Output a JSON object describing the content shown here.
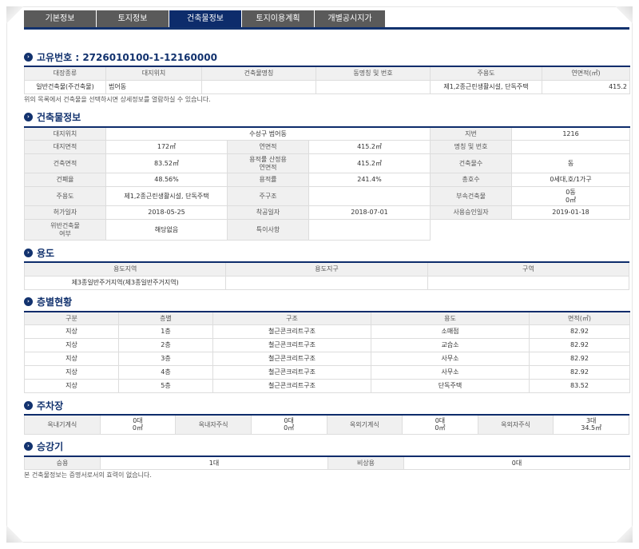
{
  "tabs": [
    "기본정보",
    "토지정보",
    "건축물정보",
    "토지이용계획",
    "개별공시지가"
  ],
  "active_tab": 2,
  "bullet_icon": "›",
  "unique_id_title": "고유번호 : 2726010100-1-12160000",
  "ledger": {
    "headers": [
      "대장종류",
      "대지위치",
      "건축물명칭",
      "동명칭 및 번호",
      "주용도",
      "연면적(㎡)"
    ],
    "row": [
      "일반건축물(주건축물)",
      "범어동",
      "",
      "",
      "제1,2종근린생활시설, 단독주택",
      "415.2"
    ],
    "note": "위의 목록에서 건축물을 선택하시면 상세정보를 열람하실 수 있습니다."
  },
  "building_info": {
    "title": "건축물정보",
    "site_location_label": "대지위치",
    "site_location": "수성구 범어동",
    "lot_label": "지번",
    "lot": "1216",
    "site_area_label": "대지면적",
    "site_area": "172㎡",
    "total_floor_area_label": "연면적",
    "total_floor_area": "415.2㎡",
    "name_label": "명칭 및 번호",
    "name": "",
    "building_area_label": "건축면적",
    "building_area": "83.52㎡",
    "far_floor_area_label": "용적률 산정용\n연면적",
    "far_floor_area": "415.2㎡",
    "building_count_label": "건축물수",
    "building_count": "동",
    "bcr_label": "건폐율",
    "bcr": "48.56%",
    "far_label": "용적률",
    "far": "241.4%",
    "households_label": "총호수",
    "households": "0세대,호/1가구",
    "main_use_label": "주용도",
    "main_use": "제1,2종근린생활시설, 단독주택",
    "main_structure_label": "주구조",
    "main_structure": "",
    "annex_label": "부속건축물",
    "annex": "0동\n0㎡",
    "permit_date_label": "허가일자",
    "permit_date": "2018-05-25",
    "start_date_label": "착공일자",
    "start_date": "2018-07-01",
    "approval_date_label": "사용승인일자",
    "approval_date": "2019-01-18",
    "violation_label": "위반건축물\n여부",
    "violation": "해당없음",
    "remarks_label": "특이사항",
    "remarks": ""
  },
  "usage": {
    "title": "용도",
    "headers": [
      "용도지역",
      "용도지구",
      "구역"
    ],
    "row": [
      "제3종일반주거지역(제3종일반주거지역)",
      "",
      ""
    ]
  },
  "floors": {
    "title": "층별현황",
    "headers": [
      "구분",
      "층별",
      "구조",
      "용도",
      "면적(㎡)"
    ],
    "rows": [
      [
        "지상",
        "1층",
        "철근콘크리트구조",
        "소매점",
        "82.92"
      ],
      [
        "지상",
        "2층",
        "철근콘크리트구조",
        "교습소",
        "82.92"
      ],
      [
        "지상",
        "3층",
        "철근콘크리트구조",
        "사무소",
        "82.92"
      ],
      [
        "지상",
        "4층",
        "철근콘크리트구조",
        "사무소",
        "82.92"
      ],
      [
        "지상",
        "5층",
        "철근콘크리트구조",
        "단독주택",
        "83.52"
      ]
    ]
  },
  "parking": {
    "title": "주차장",
    "items": [
      {
        "label": "옥내기계식",
        "value": "0대\n0㎡"
      },
      {
        "label": "옥내자주식",
        "value": "0대\n0㎡"
      },
      {
        "label": "옥외기계식",
        "value": "0대\n0㎡"
      },
      {
        "label": "옥외자주식",
        "value": "3대\n34.5㎡"
      }
    ]
  },
  "elevator": {
    "title": "승강기",
    "passenger_label": "승용",
    "passenger": "1대",
    "emergency_label": "비상용",
    "emergency": "0대"
  },
  "footer_note": "본 건축물정보는 증명서로서의 효력이 없습니다."
}
